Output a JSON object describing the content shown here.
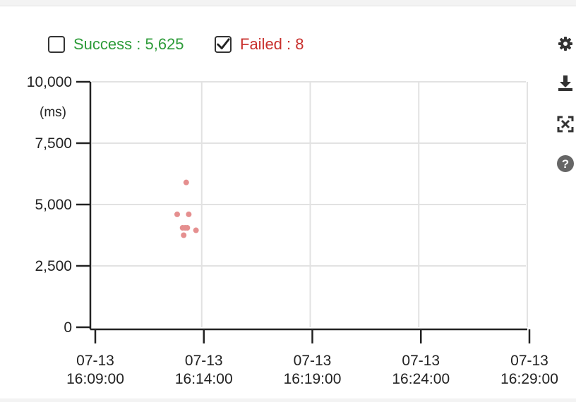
{
  "legend": {
    "success": {
      "label": "Success : 5,625",
      "checked": false,
      "color": "#2e9c3a"
    },
    "failed": {
      "label": "Failed : 8",
      "checked": true,
      "color": "#c8302d"
    }
  },
  "toolbar": {
    "settings_icon": "gear-icon",
    "download_icon": "download-icon",
    "zoom_icon": "zoom-reset-icon",
    "help_icon": "help-icon"
  },
  "chart_data": {
    "type": "scatter",
    "unit_label": "(ms)",
    "ylim": [
      0,
      10000
    ],
    "yticks": [
      0,
      2500,
      5000,
      7500,
      10000
    ],
    "ytick_labels": [
      "0",
      "2,500",
      "5,000",
      "7,500",
      "10,000"
    ],
    "xlim": [
      "2024-07-13 16:09:00",
      "2024-07-13 16:29:00"
    ],
    "xticks": [
      {
        "date": "07-13",
        "time": "16:09:00"
      },
      {
        "date": "07-13",
        "time": "16:14:00"
      },
      {
        "date": "07-13",
        "time": "16:19:00"
      },
      {
        "date": "07-13",
        "time": "16:24:00"
      },
      {
        "date": "07-13",
        "time": "16:29:00"
      }
    ],
    "grid": true,
    "series": [
      {
        "name": "Failed",
        "color": "#e58f8f",
        "points": [
          {
            "x": "16:13:00",
            "y": 4600
          },
          {
            "x": "16:13:25",
            "y": 5900
          },
          {
            "x": "16:13:32",
            "y": 4600
          },
          {
            "x": "16:13:15",
            "y": 4050
          },
          {
            "x": "16:13:22",
            "y": 4050
          },
          {
            "x": "16:13:28",
            "y": 4050
          },
          {
            "x": "16:13:18",
            "y": 3750
          },
          {
            "x": "16:13:52",
            "y": 3950
          }
        ]
      }
    ]
  }
}
